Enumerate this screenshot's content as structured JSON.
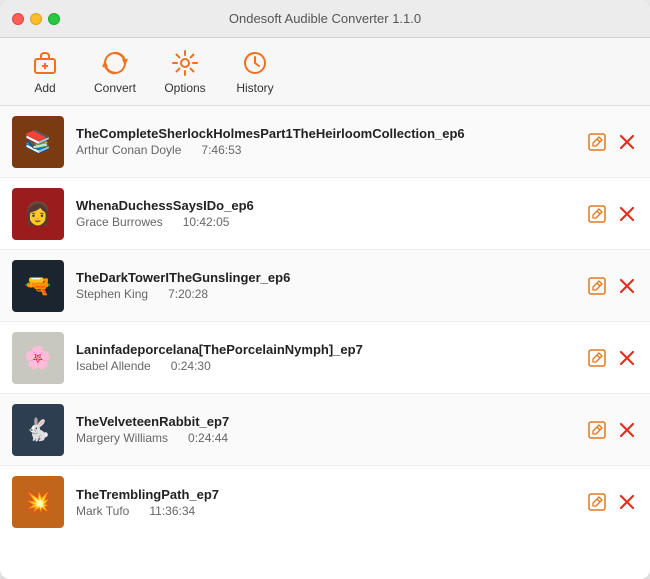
{
  "window": {
    "title": "Ondesoft Audible Converter 1.1.0"
  },
  "toolbar": {
    "buttons": [
      {
        "id": "add",
        "label": "Add",
        "icon": "add"
      },
      {
        "id": "convert",
        "label": "Convert",
        "icon": "convert"
      },
      {
        "id": "options",
        "label": "Options",
        "icon": "options"
      },
      {
        "id": "history",
        "label": "History",
        "icon": "history"
      }
    ]
  },
  "items": [
    {
      "id": 1,
      "title": "TheCompleteSherlockHolmesPart1TheHeirloomCollection_ep6",
      "author": "Arthur Conan Doyle",
      "duration": "7:46:53",
      "thumb_emoji": "📚",
      "thumb_class": "thumb-1"
    },
    {
      "id": 2,
      "title": "WhenaDuchessSaysIDo_ep6",
      "author": "Grace Burrowes",
      "duration": "10:42:05",
      "thumb_emoji": "👩",
      "thumb_class": "thumb-2"
    },
    {
      "id": 3,
      "title": "TheDarkTowerITheGunslinger_ep6",
      "author": "Stephen King",
      "duration": "7:20:28",
      "thumb_emoji": "🔫",
      "thumb_class": "thumb-3"
    },
    {
      "id": 4,
      "title": "Laninfadeporcelana[ThePorcelainNymph]_ep7",
      "author": "Isabel Allende",
      "duration": "0:24:30",
      "thumb_emoji": "🌸",
      "thumb_class": "thumb-4"
    },
    {
      "id": 5,
      "title": "TheVelveteenRabbit_ep7",
      "author": "Margery Williams",
      "duration": "0:24:44",
      "thumb_emoji": "🐇",
      "thumb_class": "thumb-5"
    },
    {
      "id": 6,
      "title": "TheTremblingPath_ep7",
      "author": "Mark Tufo",
      "duration": "11:36:34",
      "thumb_emoji": "💥",
      "thumb_class": "thumb-6"
    }
  ],
  "actions": {
    "edit_symbol": "⊡",
    "delete_symbol": "✕"
  }
}
